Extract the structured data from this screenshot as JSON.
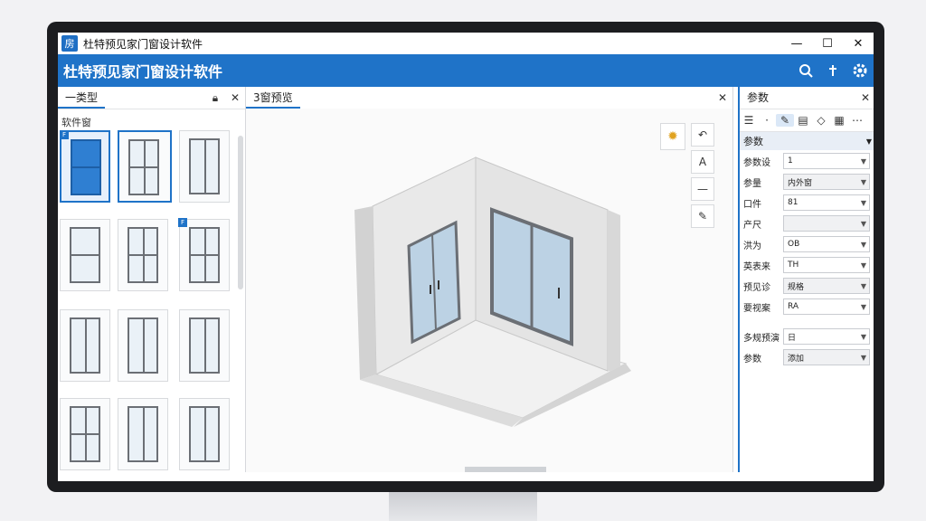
{
  "window": {
    "title": "杜特预见家门窗设计软件",
    "app_icon": "房",
    "minimize": "—",
    "maximize": "☐",
    "close": "✕"
  },
  "appbar": {
    "title": "杜特预见家门窗设计软件"
  },
  "left_panel": {
    "tab": "一类型",
    "category": "软件窗"
  },
  "center_panel": {
    "tab": "3窗预览"
  },
  "right_panel": {
    "tab": "参数",
    "section": "参数",
    "rows": [
      {
        "label": "参数设",
        "value": "1",
        "disabled": false
      },
      {
        "label": "参量",
        "value": "内外窗",
        "disabled": true
      },
      {
        "label": "口件",
        "value": "81",
        "disabled": false
      },
      {
        "label": "产尺",
        "value": "",
        "disabled": true
      },
      {
        "label": "洪为",
        "value": "OB",
        "disabled": false
      },
      {
        "label": "英表来",
        "value": "TH",
        "disabled": false
      },
      {
        "label": "预见诊",
        "value": "规格",
        "disabled": true
      },
      {
        "label": "要视案",
        "value": "RA",
        "disabled": false
      }
    ],
    "rows2": [
      {
        "label": "多规预演",
        "value": "日",
        "disabled": false
      },
      {
        "label": "参数",
        "value": "添加",
        "disabled": true
      }
    ]
  }
}
